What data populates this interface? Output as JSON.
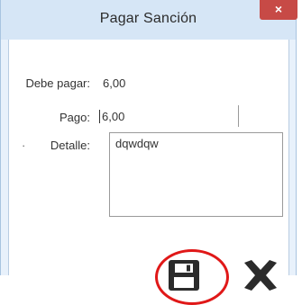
{
  "window": {
    "title": "Pagar Sanción",
    "close_glyph": "×"
  },
  "form": {
    "debe_label": "Debe pagar:",
    "debe_value": "6,00",
    "pago_label": "Pago:",
    "pago_value": "6,00",
    "detalle_label": "Detalle:",
    "detalle_value": "dqwdqw",
    "bullet": "·"
  },
  "actions": {
    "save_icon": "floppy-disk-icon",
    "cancel_icon": "x-icon"
  },
  "colors": {
    "title_bar": "#d6e6f6",
    "close_button": "#c74a46",
    "highlight_circle": "#e01818",
    "icon_dark": "#2b2b2b"
  }
}
